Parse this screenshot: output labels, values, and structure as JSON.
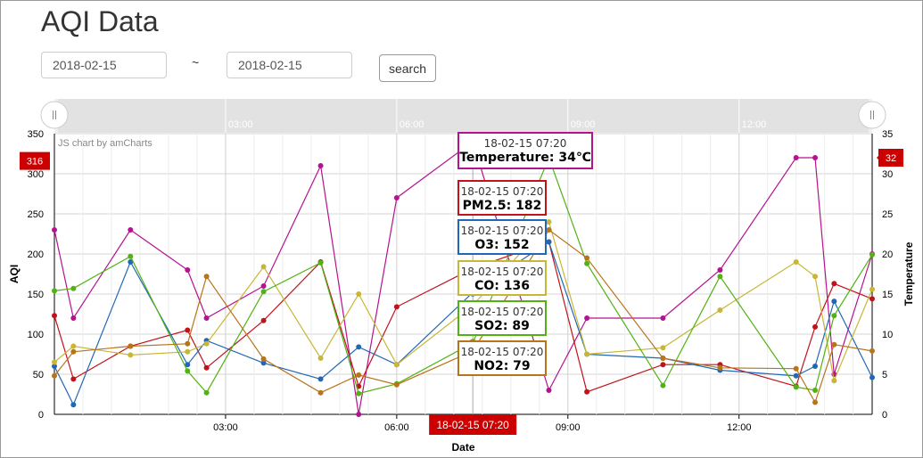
{
  "page": {
    "title": "AQI Data",
    "start_date": "2018-02-15",
    "end_date": "2018-02-15",
    "separator": "~",
    "search_label": "search",
    "credit": "JS chart by amCharts"
  },
  "chart_data": {
    "type": "line",
    "xlabel": "Date",
    "ylabel_left": "AQI",
    "ylabel_right": "Temperature",
    "ylim_left": [
      0,
      350
    ],
    "ylim_right": [
      0,
      35
    ],
    "left_ticks": [
      "0",
      "50",
      "100",
      "150",
      "200",
      "250",
      "300",
      "350"
    ],
    "right_ticks": [
      "0",
      "5",
      "10",
      "15",
      "20",
      "25",
      "30",
      "35"
    ],
    "x_ticks": [
      "03:00",
      "06:00",
      "09:00",
      "12:00"
    ],
    "scrollbar_ticks": [
      "03:00",
      "06:00",
      "09:00",
      "12:00"
    ],
    "grid": true,
    "cursor": {
      "time": "18-02-15 07:20",
      "left_value": "316",
      "right_value": "32"
    },
    "x": [
      "00:00",
      "00:20",
      "01:20",
      "02:20",
      "02:40",
      "03:40",
      "04:40",
      "05:20",
      "06:00",
      "07:20",
      "08:40",
      "09:20",
      "10:40",
      "11:40",
      "13:00",
      "13:20",
      "13:40",
      "14:20"
    ],
    "series": [
      {
        "name": "Temperature",
        "axis": "right",
        "color": "#b5128f",
        "values": [
          23,
          12,
          23,
          18,
          12,
          16,
          31,
          0,
          27,
          34,
          3,
          12,
          12,
          18,
          32,
          32,
          5,
          20
        ]
      },
      {
        "name": "PM2.5",
        "axis": "left",
        "color": "#c0131b",
        "values": [
          123,
          44,
          85,
          105,
          58,
          117,
          190,
          35,
          134,
          182,
          215,
          28,
          62,
          62,
          35,
          109,
          163,
          144
        ]
      },
      {
        "name": "O3",
        "axis": "left",
        "color": "#2167b5",
        "values": [
          60,
          12,
          190,
          62,
          92,
          64,
          44,
          84,
          62,
          152,
          215,
          75,
          70,
          55,
          48,
          60,
          141,
          46
        ]
      },
      {
        "name": "CO",
        "axis": "left",
        "color": "#c8b637",
        "values": [
          65,
          85,
          74,
          78,
          88,
          184,
          70,
          150,
          62,
          136,
          240,
          75,
          83,
          130,
          190,
          172,
          42,
          156
        ]
      },
      {
        "name": "SO2",
        "axis": "left",
        "color": "#52b213",
        "values": [
          154,
          157,
          197,
          54,
          27,
          153,
          189,
          26,
          38,
          89,
          320,
          188,
          36,
          172,
          34,
          30,
          123,
          199
        ]
      },
      {
        "name": "NO2",
        "axis": "left",
        "color": "#b7741b",
        "values": [
          48,
          78,
          85,
          88,
          172,
          69,
          27,
          49,
          37,
          79,
          230,
          195,
          70,
          58,
          57,
          15,
          87,
          79
        ]
      }
    ],
    "balloons": [
      {
        "series": "Temperature",
        "time": "18-02-15 07:20",
        "text": "Temperature: 34℃"
      },
      {
        "series": "PM2.5",
        "time": "18-02-15 07:20",
        "text": "PM2.5: 182"
      },
      {
        "series": "O3",
        "time": "18-02-15 07:20",
        "text": "O3: 152"
      },
      {
        "series": "CO",
        "time": "18-02-15 07:20",
        "text": "CO: 136"
      },
      {
        "series": "SO2",
        "time": "18-02-15 07:20",
        "text": "SO2: 89"
      },
      {
        "series": "NO2",
        "time": "18-02-15 07:20",
        "text": "NO2: 79"
      }
    ]
  }
}
